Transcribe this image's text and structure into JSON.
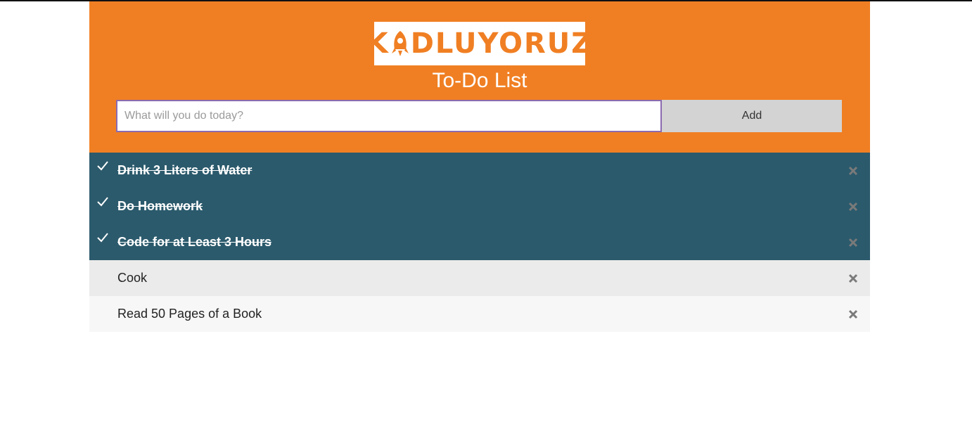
{
  "header": {
    "logo_text_pre": "K",
    "logo_text_post": "DLUYORUZ",
    "title": "To-Do List"
  },
  "input": {
    "placeholder": "What will you do today?",
    "value": ""
  },
  "add_button": {
    "label": "Add"
  },
  "colors": {
    "header_bg": "#f07f23",
    "done_bg": "#2b5a6c",
    "row_odd": "#ebebeb",
    "row_even": "#f7f7f7",
    "input_border": "#8a6bb0"
  },
  "todos": [
    {
      "text": "Drink 3 Liters of Water",
      "done": true
    },
    {
      "text": "Do Homework",
      "done": true
    },
    {
      "text": "Code for at Least 3 Hours",
      "done": true
    },
    {
      "text": "Cook",
      "done": false
    },
    {
      "text": "Read 50 Pages of a Book",
      "done": false
    }
  ],
  "icons": {
    "check": "check-icon",
    "close": "close-icon",
    "logo_o": "rocket-icon"
  }
}
